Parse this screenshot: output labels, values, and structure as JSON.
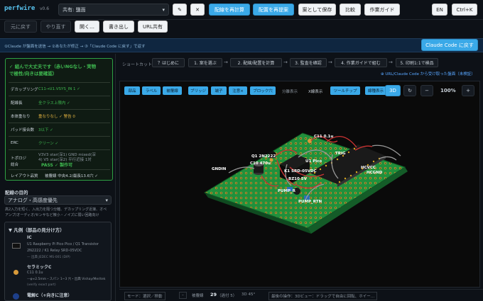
{
  "app": {
    "logo": "perfwire",
    "version": "v0.6",
    "file_select": "共有: 鹽面"
  },
  "toolbar": {
    "wrench": "🔧",
    "close": "✕",
    "route": "配線を再計算",
    "layout": "配置を再提案",
    "save": "案として保存",
    "compare": "比較",
    "guide": "作業ガイド",
    "lang": "EN",
    "shortcut": "Ctrl+K"
  },
  "toolbar2": {
    "undo": "元に戻す",
    "redo": "やり直す",
    "open": "開く…",
    "export": "書き出し",
    "url": "URL共有"
  },
  "flow": {
    "text": "①Claude が盤面を送信 → ②あなたが修正 → ③「Claude Code に戻す」で返す",
    "button": "Claude Code に戻す"
  },
  "shortcuts": {
    "label": "ショートカット:",
    "steps": [
      "？はじめに",
      "1. 案を選ぶ",
      "2. 配線/配置を計算",
      "3. 監査を確認",
      "4. 作業ガイドで組む",
      "5. 印刷1:1で検品"
    ]
  },
  "status_note": "⊕ URL/Claude Code から受け取った盤面（未検証）",
  "verdict": {
    "line1": "✓ 組んで大丈夫です（赤いNGなし・実物",
    "line2": "で極性/向きは要確認）"
  },
  "audit": [
    {
      "k": "デカップリング",
      "v": "C11→U1.VSYS_IN 1 ✓"
    },
    {
      "k": "配線長",
      "v": "全クラス上限内 ✓"
    },
    {
      "k": "本体重なり",
      "v": "重なりなし ✓  警告 0"
    },
    {
      "k": "パッド接合数",
      "v": "3以下 ✓"
    },
    {
      "k": "ERC",
      "v": "クリーン ✓"
    },
    {
      "k": "トポロジ",
      "v": "V3V3 star(深1) GND mixed(深\n4) V5 star(深2) 平行近接 1対"
    },
    {
      "k": "総合",
      "v": "PASS ✓ 製作可"
    },
    {
      "k": "レイアウト品質",
      "v": "被覆線 中央4.2/最長13.6穴 ✓"
    }
  ],
  "purpose": {
    "title": "配線の目的",
    "select": "アナログ・高感度優先",
    "desc": "高2入力を短く、入出力を隔つ分離、デカップリング近接、オペ\nアンプ/オーディオ/センサなど微小・ノイズに弱い回路向け"
  },
  "legend": {
    "title": "▼ 凡例（部品の見分け方）",
    "items": [
      {
        "name": "IC",
        "l1": "U1 Raspberry Pi Pico Pico / Q1 Transistor",
        "l2": "2N2222 / K1 Relay SRD-05VDC",
        "l3": "— 出典 JEDEC MS-001 (DIP)"
      },
      {
        "name": "セラミックC",
        "l1": "C11 0.1u",
        "l2": "—φ≈2.5mm・スパン 1~3 穴・出典 Vishay/Meritek",
        "l3": "(verify exact part)"
      },
      {
        "name": "電解C（+向きに注意）",
        "l1": "",
        "l2": "",
        "l3": ""
      }
    ]
  },
  "canvas_tools": {
    "buttons": [
      "部品",
      "ラベル",
      "被覆線",
      "ブリッジ",
      "端子",
      "注意×",
      "ブロック穴"
    ],
    "split": "分離表示",
    "xray": "X線表示",
    "tooltip": "ツールチップ",
    "wire_color": "線種表示",
    "mode3d": "3D",
    "zoom": "100%",
    "minus": "−",
    "plus": "+",
    "refresh": "↻"
  },
  "board_labels": [
    "C11 0.1u",
    "U1 Pico",
    "TRIG",
    "GNDIN",
    "C10 470u",
    "HCVCC",
    "HCGND",
    "PUMP_R",
    "Q1 2N2222",
    "K1 SRD-05VDC",
    "PUMP_RTN",
    "BZ10 5V"
  ],
  "statusbar": {
    "mode": "モード：選択／移動",
    "dash": "–",
    "wires_label": "被覆線",
    "wires": "29",
    "adj": "（過付 5）",
    "view": "3D 45°",
    "tip": "最後の操作：3Dビュー：ドラッグで自由に回転、ホイー…"
  },
  "colors": {
    "accent": "#3aa9e8",
    "pass": "#3fb950",
    "warn": "#e3b341",
    "board": "#1f8a3a"
  }
}
